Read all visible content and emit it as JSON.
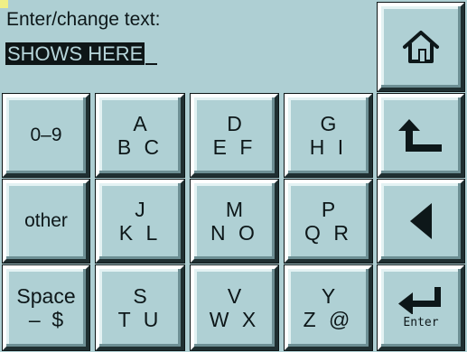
{
  "prompt": "Enter/change text:",
  "input": {
    "value": "SHOWS HERE",
    "cursor": "_"
  },
  "keys": {
    "digits": {
      "label": "0–9"
    },
    "other": {
      "label": "other"
    },
    "space": {
      "line1": "Space",
      "line2": "–  $"
    },
    "abc": {
      "line1": "A",
      "line2": "B C"
    },
    "def": {
      "line1": "D",
      "line2": "E F"
    },
    "ghi": {
      "line1": "G",
      "line2": "H I"
    },
    "jkl": {
      "line1": "J",
      "line2": "K L"
    },
    "mno": {
      "line1": "M",
      "line2": "N O"
    },
    "pqr": {
      "line1": "P",
      "line2": "Q R"
    },
    "stu": {
      "line1": "S",
      "line2": "T U"
    },
    "vwx": {
      "line1": "V",
      "line2": "W X"
    },
    "yz": {
      "line1": "Y",
      "line2": "Z @"
    },
    "enter": {
      "label": "Enter"
    }
  },
  "icons": {
    "home": "home-icon",
    "back": "return-arrow-icon",
    "left": "left-triangle-icon",
    "enter": "enter-arrow-icon"
  },
  "colors": {
    "background": "#aecfd3",
    "accent": "#f0ef86",
    "text": "#0d1719"
  }
}
